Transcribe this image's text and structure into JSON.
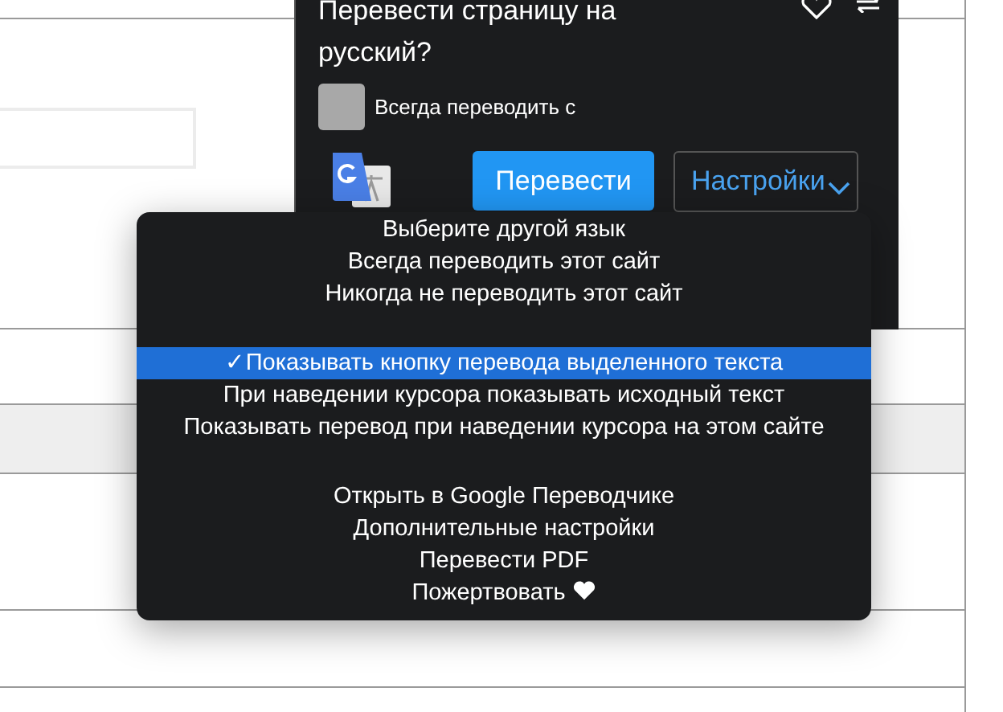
{
  "translate_popup": {
    "title": "Перевести страницу на русский?",
    "always_translate": {
      "label": "Всегда переводить с",
      "checked": false
    },
    "translate_button": "Перевести",
    "settings_button": "Настройки"
  },
  "settings_menu": {
    "check_mark": "✓",
    "groups": [
      [
        {
          "kind": "option",
          "label": "Выберите другой язык",
          "checked": false,
          "selected": false
        },
        {
          "kind": "option",
          "label": "Всегда переводить этот сайт",
          "checked": false,
          "selected": false
        },
        {
          "kind": "option",
          "label": "Никогда не переводить этот сайт",
          "checked": false,
          "selected": false
        }
      ],
      [
        {
          "kind": "option",
          "label": "Показывать кнопку перевода выделенного текста",
          "checked": true,
          "selected": true
        },
        {
          "kind": "option",
          "label": "При наведении курсора показывать исходный текст",
          "checked": false,
          "selected": false
        },
        {
          "kind": "option",
          "label": "Показывать перевод при наведении курсора на этом сайте",
          "checked": false,
          "selected": false
        }
      ],
      [
        {
          "kind": "option",
          "label": "Открыть в Google Переводчике",
          "checked": false,
          "selected": false
        },
        {
          "kind": "option",
          "label": "Дополнительные настройки",
          "checked": false,
          "selected": false
        },
        {
          "kind": "option",
          "label": "Перевести PDF",
          "checked": false,
          "selected": false
        },
        {
          "kind": "donate",
          "label": "Пожертвовать",
          "checked": false,
          "selected": false
        }
      ]
    ]
  }
}
